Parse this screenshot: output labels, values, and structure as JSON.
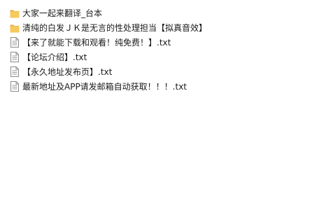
{
  "items": [
    {
      "name": "大家一起来翻译_台本",
      "icon": "folder-icon",
      "kind": "folder"
    },
    {
      "name": "清纯的白发ＪＫ是无言的性处理担当【拟真音效】",
      "icon": "folder-icon",
      "kind": "folder"
    },
    {
      "name": "【来了就能下载和观看！纯免费！】.txt",
      "icon": "text-file-icon",
      "kind": "file"
    },
    {
      "name": "【论坛介绍】.txt",
      "icon": "text-file-icon",
      "kind": "file"
    },
    {
      "name": "【永久地址发布页】.txt",
      "icon": "text-file-icon",
      "kind": "file"
    },
    {
      "name": "最新地址及APP请发邮箱自动获取！！！.txt",
      "icon": "text-file-icon",
      "kind": "file"
    }
  ],
  "colors": {
    "folder_fill": "#f5c95c",
    "folder_dark": "#dfa93a",
    "file_stroke": "#8a8a8a",
    "text": "#1a1a1a"
  }
}
